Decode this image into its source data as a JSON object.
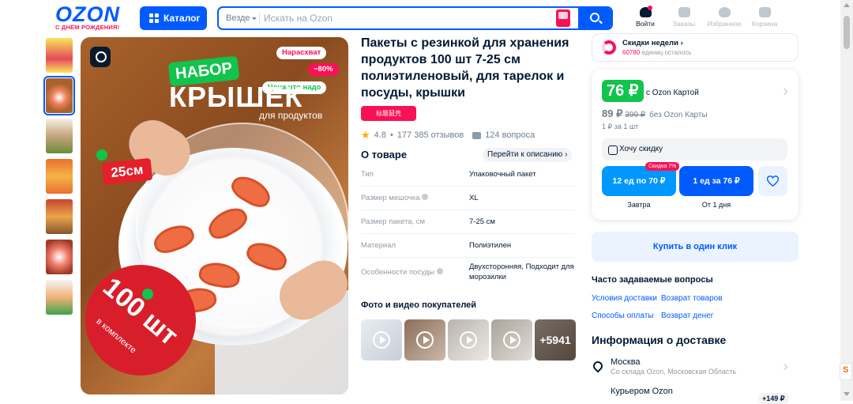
{
  "header": {
    "logo_text": "OZON",
    "logo_sub": "С ДНЁМ РОЖДЕНИЯ!",
    "catalog_label": "Каталог",
    "search_scope": "Везде",
    "search_placeholder": "Искать на Ozon",
    "nav": [
      {
        "label": "Войти",
        "icon": "user-icon"
      },
      {
        "label": "Заказы",
        "icon": "box-icon"
      },
      {
        "label": "Избранное",
        "icon": "heart-icon"
      },
      {
        "label": "Корзина",
        "icon": "cart-icon"
      }
    ]
  },
  "gallery": {
    "badges": {
      "hot": "Нарасхват",
      "discount": "−80%",
      "good_price": "Цена что надо"
    },
    "overlay": {
      "nabor": "НАБОР",
      "kryshek": "КРЫШЕК",
      "dlya": "для продуктов",
      "size": "25см",
      "count": "100 шт",
      "count_sub": "в комплекте"
    }
  },
  "product": {
    "title": "Пакеты с резинкой для хранения продуктов 100 шт 7-25 см полиэтиленовый, для тарелок и посуды, крышки",
    "brand_chip": "标题鼠壳",
    "rating": "4.8",
    "reviews": "177 385 отзывов",
    "questions": "124 вопроса",
    "about_title": "О товаре",
    "goto_description": "Перейти к описанию",
    "specs": [
      {
        "key": "Тип",
        "value": "Упаковочный пакет",
        "info": false
      },
      {
        "key": "Размер мешочка",
        "value": "XL",
        "info": true
      },
      {
        "key": "Размер пакета, см",
        "value": "7-25 см",
        "info": false
      },
      {
        "key": "Материал",
        "value": "Полиэтилен",
        "info": false
      },
      {
        "key": "Особенности посуды",
        "value": "Двухсторонняя, Подходит для морозилки",
        "info": true
      }
    ],
    "photos_title": "Фото и видео покупателей",
    "photos_more": "+5941"
  },
  "weekly": {
    "title": "Скидки недели",
    "count": "60780",
    "suffix": "единиц осталось"
  },
  "price": {
    "ozon_card_price": "76 ₽",
    "ozon_card_label": "с Ozon Картой",
    "regular_price": "89 ₽",
    "old_price": "399 ₽",
    "regular_label": "без Ozon Карты",
    "unit_price": "1 ₽ за 1 шт",
    "want_discount": "Хочу скидку",
    "option1": "12 ед по 70 ₽",
    "option1_badge": "Скидка 7%",
    "option1_delivery": "Завтра",
    "option2": "1 ед за 76 ₽",
    "option2_delivery": "От 1 дня"
  },
  "buy_one_click": "Купить в один клик",
  "faq": {
    "title": "Часто задаваемые вопросы",
    "links": [
      "Условия доставки",
      "Возврат товаров",
      "Способы оплаты",
      "Возврат денег"
    ]
  },
  "delivery": {
    "title": "Информация о доставке",
    "city": "Москва",
    "city_sub": "Со склада Ozon, Московская Область",
    "courier": "Курьером Ozon",
    "courier_price": "+149 ₽"
  },
  "colors": {
    "brand": "#005bff",
    "accent": "#f91155",
    "green": "#10c44c",
    "light_blue": "#0097ff"
  }
}
